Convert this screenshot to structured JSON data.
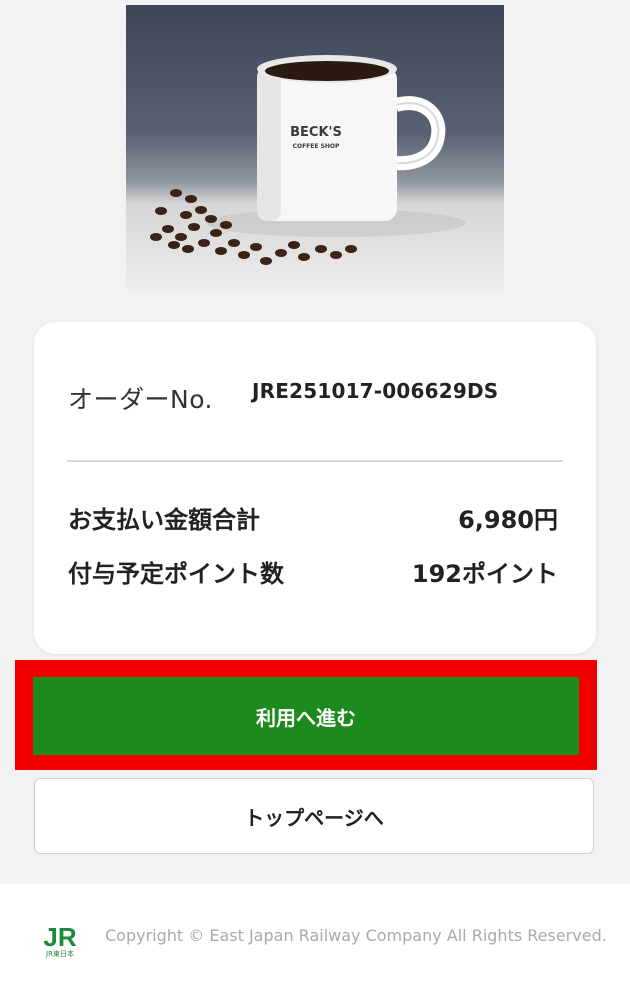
{
  "hero": {
    "mug_brand": "BECK'S",
    "mug_subtitle": "COFFEE SHOP"
  },
  "summary": {
    "order_label": "オーダーNo.",
    "order_number": "JRE251017-006629DS",
    "payment_label": "お支払い金額合計",
    "payment_value": "6,980円",
    "points_label": "付与予定ポイント数",
    "points_value": "192ポイント"
  },
  "buttons": {
    "proceed_label": "利用へ進む",
    "top_page_label": "トップページへ"
  },
  "footer": {
    "logo_text": "JR",
    "logo_subtext": "JR東日本",
    "copyright": "Copyright © East Japan Railway Company All Rights Reserved."
  },
  "colors": {
    "primary_green": "#1d8a1e",
    "highlight_red": "#f20000",
    "jr_green": "#1d8a3c"
  }
}
